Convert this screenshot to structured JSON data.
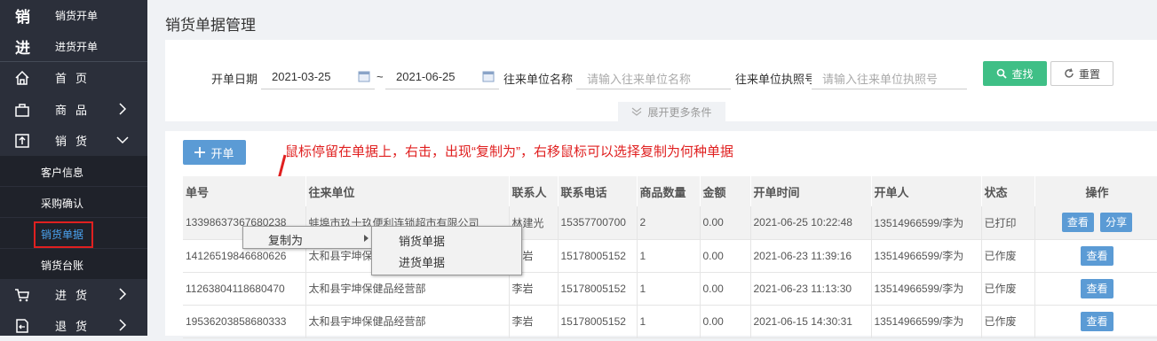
{
  "sidebar": {
    "quick": [
      {
        "big": "销",
        "label": "销货开单"
      },
      {
        "big": "进",
        "label": "进货开单"
      }
    ],
    "nav": {
      "home": "首页",
      "goods": "商品",
      "sales": "销货",
      "purchase": "进货",
      "returns": "退货"
    },
    "sales_sub": [
      "客户信息",
      "采购确认",
      "销货单据",
      "销货台账"
    ]
  },
  "page": {
    "title": "销货单据管理"
  },
  "filter": {
    "date_label": "开单日期",
    "date_from": "2021-03-25",
    "tilde": "~",
    "date_to": "2021-06-25",
    "unit_label": "往来单位名称",
    "unit_placeholder": "请输入往来单位名称",
    "license_label": "往来单位执照号",
    "license_placeholder": "请输入往来单位执照号",
    "find": "查找",
    "reset": "重置",
    "expand": "展开更多条件"
  },
  "list": {
    "open_button": "开单",
    "note": "鼠标停留在单据上，右击，出现“复制为”，右移鼠标可以选择复制为何种单据",
    "headers": [
      "单号",
      "往来单位",
      "联系人",
      "联系电话",
      "商品数量",
      "金额",
      "开单时间",
      "开单人",
      "状态",
      "操作"
    ],
    "rows": [
      {
        "no": "13398637367680238",
        "unit": "蚌埠市玖十玖便利连锁超市有限公司",
        "contact": "林建光",
        "phone": "15357700700",
        "qty": "2",
        "amount": "0.00",
        "time": "2021-06-25 10:22:48",
        "creator": "13514966599/李为",
        "status": "已打印",
        "ops": [
          "查看",
          "分享"
        ]
      },
      {
        "no": "14126519846680626",
        "unit": "太和县宇坤保健品经营部",
        "contact": "李岩",
        "phone": "15178005152",
        "qty": "1",
        "amount": "0.00",
        "time": "2021-06-23 11:39:16",
        "creator": "13514966599/李为",
        "status": "已作废",
        "ops": [
          "查看"
        ]
      },
      {
        "no": "11263804118680470",
        "unit": "太和县宇坤保健品经营部",
        "contact": "李岩",
        "phone": "15178005152",
        "qty": "1",
        "amount": "0.00",
        "time": "2021-06-23 11:13:30",
        "creator": "13514966599/李为",
        "status": "已作废",
        "ops": [
          "查看"
        ]
      },
      {
        "no": "19536203858680333",
        "unit": "太和县宇坤保健品经营部",
        "contact": "李岩",
        "phone": "15178005152",
        "qty": "1",
        "amount": "0.00",
        "time": "2021-06-15 14:30:31",
        "creator": "13514966599/李为",
        "status": "已作废",
        "ops": [
          "查看"
        ]
      }
    ]
  },
  "context_menu": {
    "item": "复制为",
    "submenu": [
      "销货单据",
      "进货单据"
    ]
  },
  "colors": {
    "sidebar": "#2b2f3a",
    "accent": "#5b9bd5",
    "find": "#3fbf86",
    "note": "#e02020",
    "active": "#4aa3f0"
  }
}
